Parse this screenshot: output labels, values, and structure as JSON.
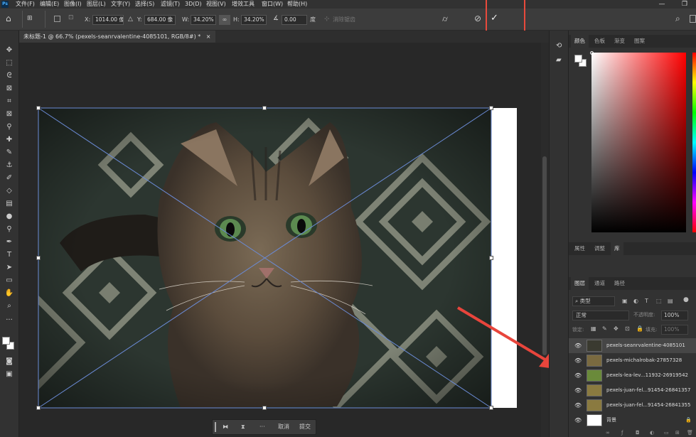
{
  "menu": {
    "app_icon": "Ps",
    "items": [
      "文件(F)",
      "编辑(E)",
      "图像(I)",
      "图层(L)",
      "文字(Y)",
      "选择(S)",
      "滤镜(T)",
      "3D(D)",
      "视图(V)",
      "增效工具",
      "窗口(W)",
      "帮助(H)"
    ]
  },
  "options": {
    "x_label": "X:",
    "x_value": "1014.00 像",
    "y_label": "Y:",
    "y_value": "684.00 像",
    "w_label": "W:",
    "w_value": "34.20%",
    "h_label": "H:",
    "h_value": "34.20%",
    "angle_value": "0.00",
    "angle_unit": "度",
    "interp_label": "消除锯齿"
  },
  "document": {
    "tab_title": "未标题-1 @ 66.7% (pexels-seanrvalentine-4085101, RGB/8#) *",
    "close": "×"
  },
  "context_bar": {
    "more": "···",
    "cancel": "取消",
    "commit": "提交"
  },
  "color_panel": {
    "tabs": [
      "颜色",
      "色板",
      "渐变",
      "图案"
    ]
  },
  "props_panel": {
    "tabs": [
      "属性",
      "调整",
      "库"
    ]
  },
  "layers_panel": {
    "tabs": [
      "图层",
      "通道",
      "路径"
    ],
    "filter_label": "类型",
    "blend_mode": "正常",
    "opacity_label": "不透明度:",
    "opacity_value": "100%",
    "lock_label": "锁定:",
    "fill_label": "填充:",
    "fill_value": "100%",
    "layers": [
      {
        "name": "pexels-seanrvalentine-4085101",
        "selected": true
      },
      {
        "name": "pexels-michalrobak-27857328",
        "selected": false
      },
      {
        "name": "pexels-lea-lev...11932-26919542",
        "selected": false
      },
      {
        "name": "pexels-juan-fel...91454-26841357",
        "selected": false
      },
      {
        "name": "pexels-juan-fel...91454-26841355",
        "selected": false
      },
      {
        "name": "背景",
        "selected": false
      }
    ]
  },
  "colors": {
    "highlight": "#e84a3c",
    "arrow": "#e8453c",
    "selection_line": "#6b8bd6"
  }
}
